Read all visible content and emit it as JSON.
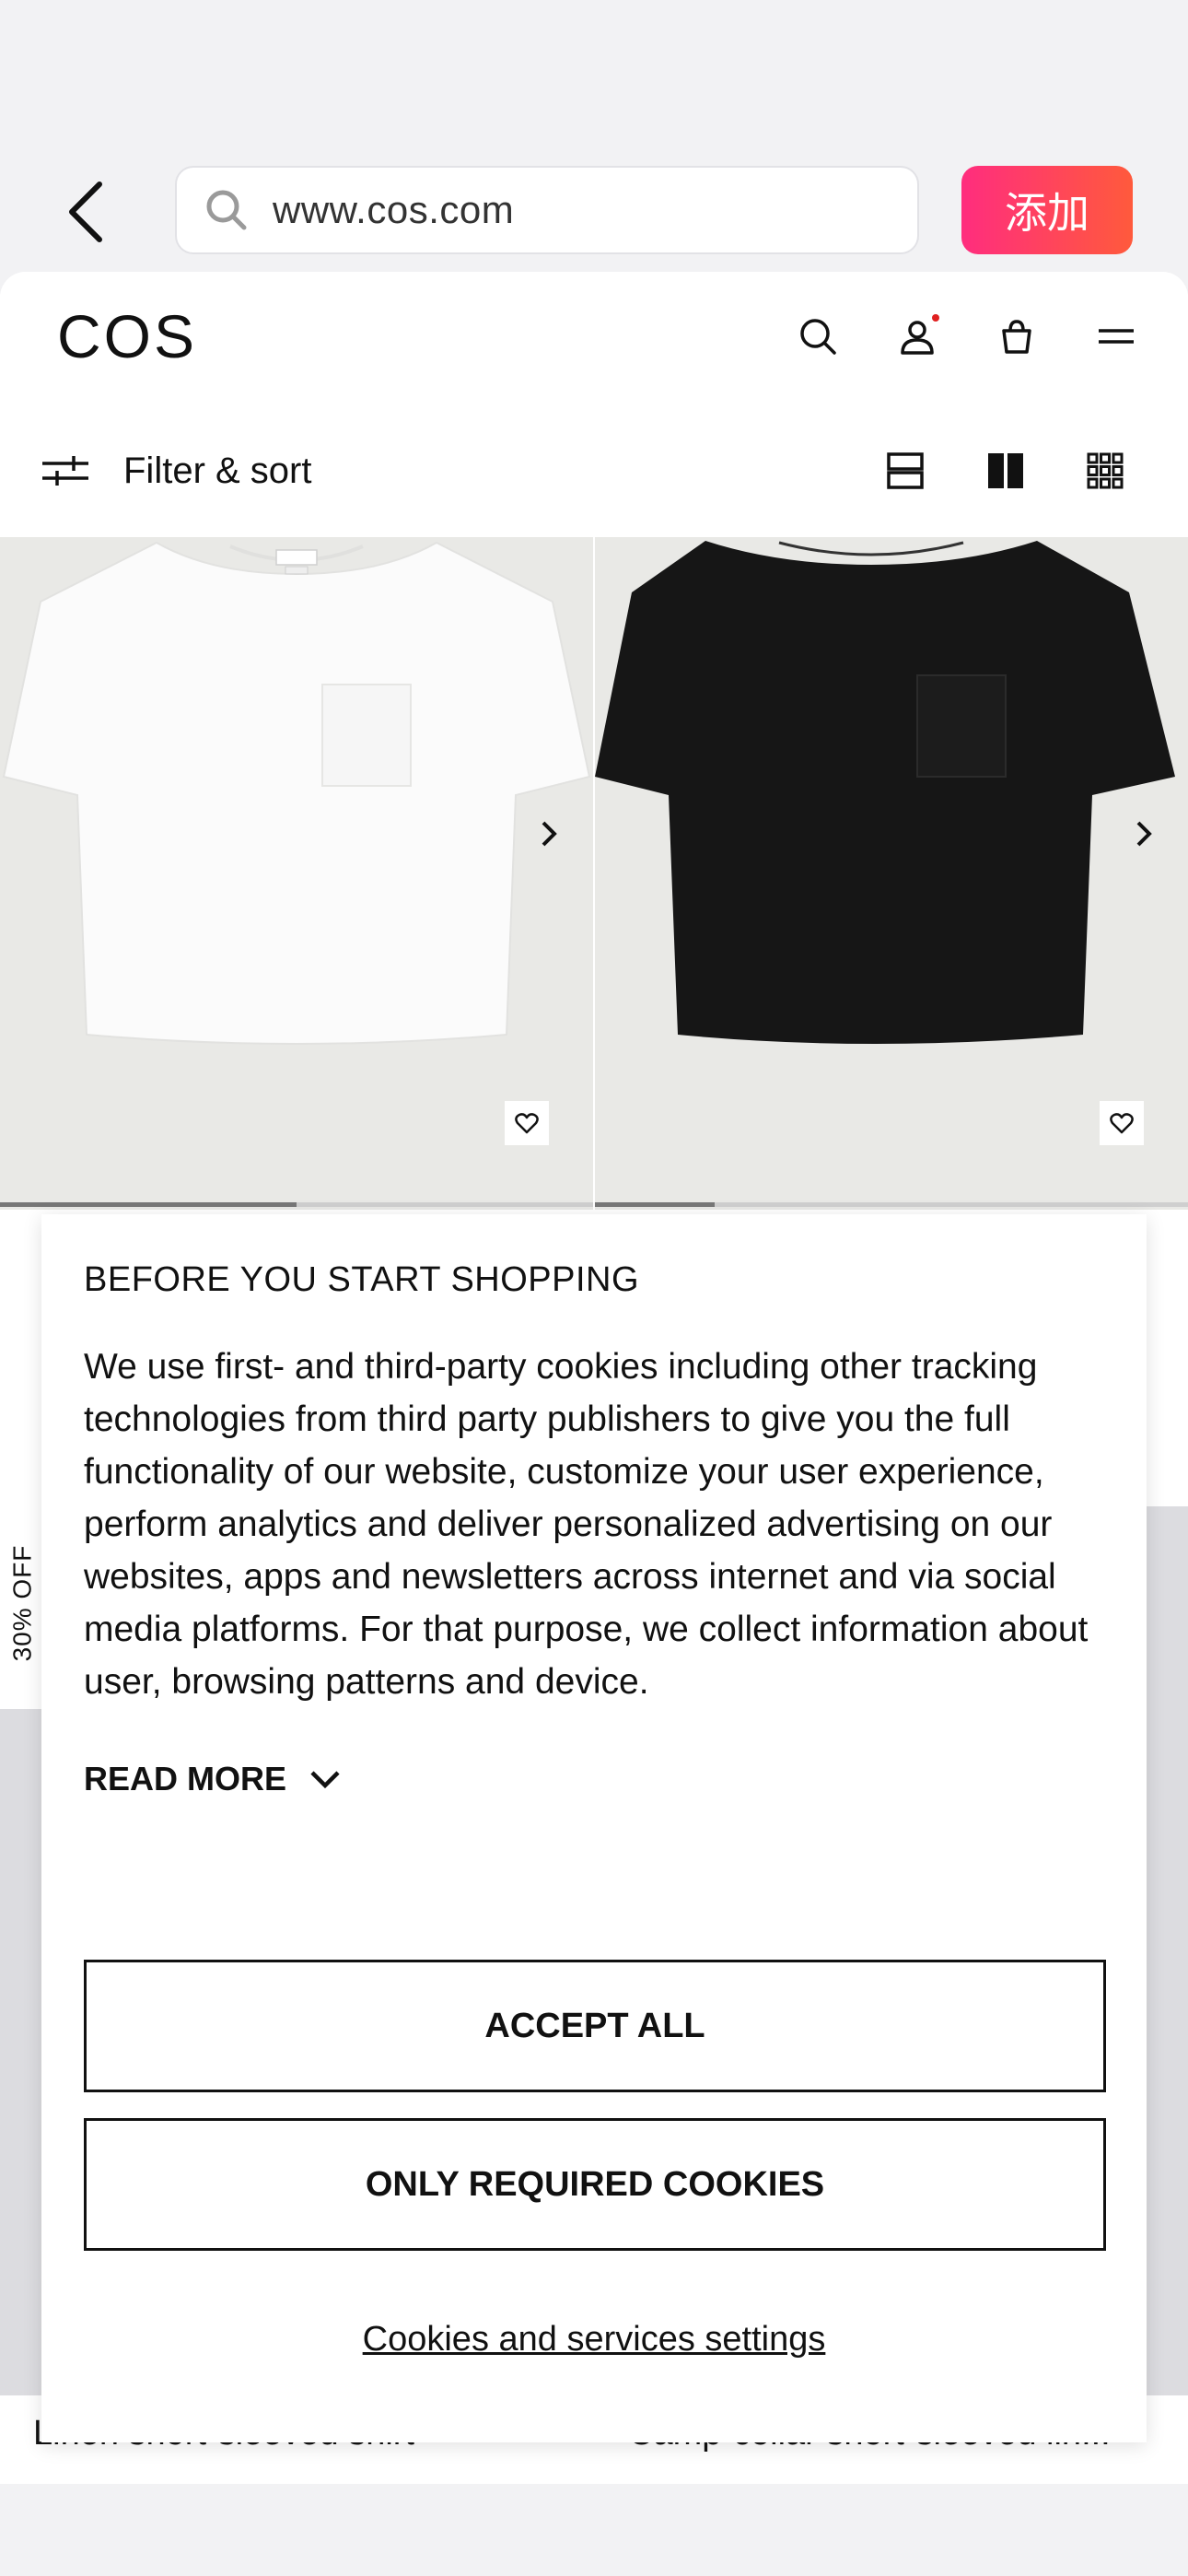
{
  "browser": {
    "url": "www.cos.com",
    "add_button_label": "添加"
  },
  "site": {
    "logo": "COS",
    "filter_label": "Filter & sort"
  },
  "products": [
    {
      "name": "Linen short-sleeved shirt"
    },
    {
      "name": "Camp-collar short-sleeved lin..."
    }
  ],
  "sale_badge": "30% OFF",
  "cookie_banner": {
    "title": "BEFORE YOU START SHOPPING",
    "body": "We use first- and third-party cookies including other tracking technologies from third party publishers to give you the full functionality of our website, customize your user experience, perform analytics and deliver personalized advertising on our websites, apps and newsletters across internet and via social media platforms. For that purpose, we collect information about user, browsing patterns and device.",
    "read_more": "READ MORE",
    "accept_all": "ACCEPT ALL",
    "only_required": "ONLY REQUIRED COOKIES",
    "settings_link": "Cookies and services settings"
  },
  "icons": {
    "back": "chevron-left-icon",
    "search": "search-icon",
    "account": "user-icon",
    "bag": "shopping-bag-icon",
    "menu": "hamburger-menu-icon",
    "filter": "sliders-icon",
    "view_list": "single-column-view-icon",
    "view_two": "two-column-view-icon",
    "view_grid": "grid-view-icon",
    "wishlist": "heart-icon",
    "next": "chevron-right-icon",
    "read_more": "chevron-down-icon"
  },
  "colors": {
    "accent_gradient_start": "#ff2d7e",
    "accent_gradient_end": "#ff5a3c",
    "sale_red": "#c8102e",
    "notification_dot": "#e02020"
  }
}
